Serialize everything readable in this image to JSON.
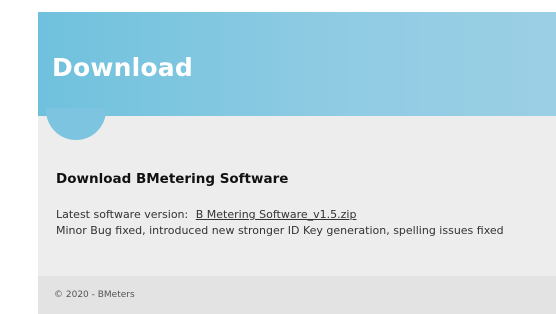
{
  "hero": {
    "title": "Download"
  },
  "download": {
    "heading": "Download BMetering Software",
    "version_label": "Latest software version:",
    "file_link": "B Metering Software_v1.5.zip",
    "changelog": "Minor Bug fixed, introduced new stronger ID Key generation, spelling issues fixed"
  },
  "footer": {
    "copyright": "© 2020 - BMeters"
  },
  "colors": {
    "hero_start": "#6fc1dd",
    "hero_end": "#9bcfe5",
    "page_background": "#ededed",
    "footer_background": "#e3e3e3"
  }
}
